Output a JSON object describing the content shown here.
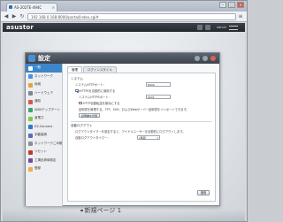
{
  "browser": {
    "tab_title": "AS-202TE-494C",
    "tab_close": "×",
    "win_min": "–",
    "win_max": "□",
    "win_close": "×",
    "back": "◀",
    "forward": "▶",
    "reload": "↻",
    "url": "192.168.0.168:8000/portal/index.cgi#",
    "menu": "≡"
  },
  "adm": {
    "logo": "asustor",
    "user": "admin"
  },
  "dialog": {
    "title": "設定",
    "sidebar": [
      {
        "label": "一般",
        "color": "#ffffff",
        "active": true
      },
      {
        "label": "ネットワーク",
        "color": "#4a90d9"
      },
      {
        "label": "地域",
        "color": "#e8a33c"
      },
      {
        "label": "ハードウェア",
        "color": "#7b8796"
      },
      {
        "label": "通知",
        "color": "#d9534f"
      },
      {
        "label": "ADMアップデート",
        "color": "#3aa36b"
      },
      {
        "label": "省電力",
        "color": "#8bc34a"
      },
      {
        "label": "EZ-Connect",
        "color": "#2b7bc0"
      },
      {
        "label": "手動接続",
        "color": "#5a6cb5"
      },
      {
        "label": "ネットワークごみ箱",
        "color": "#888f99"
      },
      {
        "label": "リセット",
        "color": "#c0392b"
      },
      {
        "label": "工場出荷時設定",
        "color": "#6d4c9f"
      },
      {
        "label": "登録",
        "color": "#f0ad4e"
      }
    ],
    "tabs": [
      "管理",
      "ログインスタイル"
    ],
    "system_section": "システム",
    "http_port_label": "システムHTTPポート：",
    "http_port_value": "8000",
    "https_auto_label": "HTTPSを自動的に使用する",
    "https_port_label": "システムHTTPSポート：",
    "https_port_value": "8001",
    "disable_default_label": "HTTP自動転送を無効にする",
    "cert_note": "証明書を管理する。FTP、SSH、およびWebサーバー証明書をインポートできます。",
    "cert_button": "証明書を管理",
    "autologout_section": "自動ログアウト",
    "autologout_note": "ログアウトタイマーを設定すると、アイドルユーザーを自動的にログアウトします。",
    "autologout_label": "自動ログアウトタイマー：",
    "autologout_value": "1時間",
    "apply": "適用"
  },
  "caption": "新規ページ 1"
}
